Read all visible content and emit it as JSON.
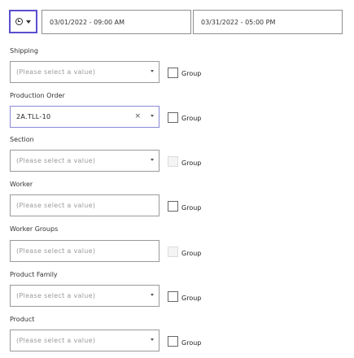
{
  "header": {
    "range_button_icon": "clock-icon",
    "start_date": "03/01/2022 - 09:00 AM",
    "end_date": "03/31/2022 - 05:00 PM"
  },
  "filters": [
    {
      "label": "Shipping",
      "placeholder": "(Please select a value)",
      "value": "",
      "has_dropdown": true,
      "group_label": "Group",
      "group_enabled": true
    },
    {
      "label": "Production Order",
      "placeholder": "",
      "value": "2A.TLL-10",
      "has_dropdown": true,
      "group_label": "Group",
      "group_enabled": true
    },
    {
      "label": "Section",
      "placeholder": "(Please select a value)",
      "value": "",
      "has_dropdown": true,
      "group_label": "Group",
      "group_enabled": false
    },
    {
      "label": "Worker",
      "placeholder": "(Please select a value)",
      "value": "",
      "has_dropdown": false,
      "group_label": "Group",
      "group_enabled": true
    },
    {
      "label": "Worker Groups",
      "placeholder": "(Please select a value)",
      "value": "",
      "has_dropdown": false,
      "group_label": "Group",
      "group_enabled": false
    },
    {
      "label": "Product Family",
      "placeholder": "(Please select a value)",
      "value": "",
      "has_dropdown": true,
      "group_label": "Group",
      "group_enabled": true
    },
    {
      "label": "Product",
      "placeholder": "(Please select a value)",
      "value": "",
      "has_dropdown": true,
      "group_label": "Group",
      "group_enabled": true
    }
  ]
}
